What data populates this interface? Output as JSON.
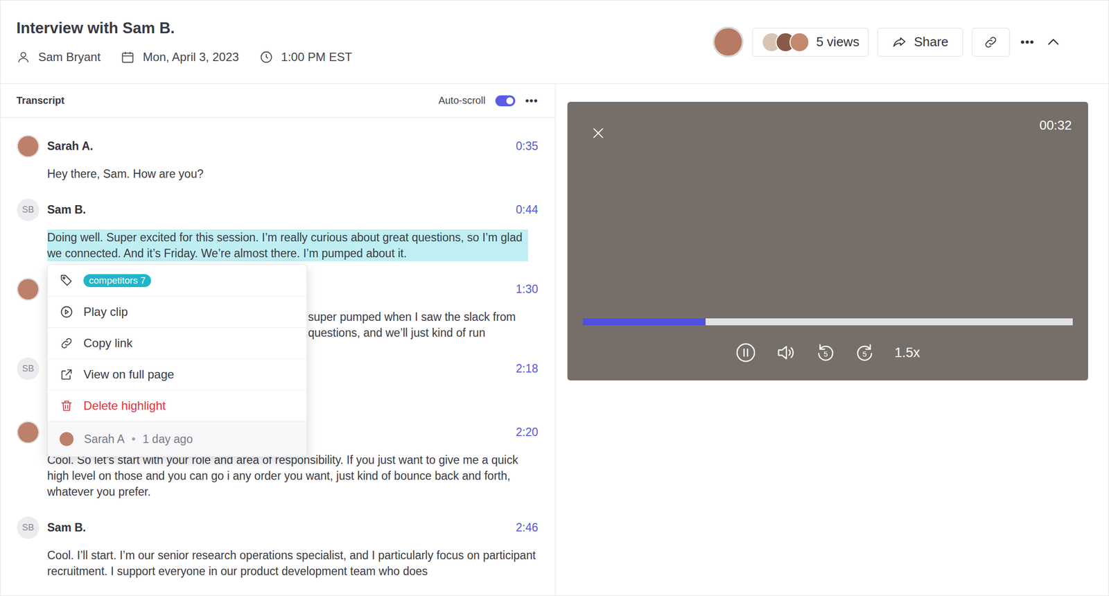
{
  "header": {
    "title": "Interview with Sam B.",
    "participant": "Sam Bryant",
    "date": "Mon, April 3, 2023",
    "time": "1:00 PM EST",
    "views": "5 views",
    "share": "Share",
    "more": "•••"
  },
  "transcript": {
    "title": "Transcript",
    "auto_scroll": {
      "label": "Auto-scroll",
      "on": true
    },
    "more": "•••",
    "entries": [
      {
        "kind": "full",
        "speaker": "Sarah A.",
        "avatar": {
          "kind": "photo"
        },
        "time": "0:35",
        "text": "Hey there, Sam. How are you?",
        "highlighted": false
      },
      {
        "kind": "full",
        "speaker": "Sam B.",
        "avatar": {
          "kind": "initials",
          "text": "SB"
        },
        "time": "0:44",
        "text": "Doing well. Super excited for this session. I’m really curious about great questions, so I’m glad we connected. And it’s Friday. We’re almost there. I’m pumped about it.",
        "highlighted": true
      },
      {
        "kind": "covered",
        "avatar": {
          "kind": "photo"
        },
        "time": "1:30",
        "lines": [
          "super pumped when I saw the slack from",
          "questions, and we’ll just kind of run"
        ],
        "highlighted": false
      },
      {
        "kind": "covered",
        "avatar": {
          "kind": "initials",
          "text": "SB"
        },
        "time": "2:18",
        "lines": [],
        "highlighted": false
      },
      {
        "kind": "full",
        "speaker": "Sarah A.",
        "avatar": {
          "kind": "photo"
        },
        "time": "2:20",
        "text": "Cool. So let’s start with your role and area of responsibility. If you just want to give me a quick high level on those and you can go i any order you want, just kind of bounce back and forth, whatever you prefer.",
        "highlighted": false
      },
      {
        "kind": "full",
        "speaker": "Sam B.",
        "avatar": {
          "kind": "initials",
          "text": "SB"
        },
        "time": "2:46",
        "text": "Cool. I’ll start. I’m our senior research operations specialist, and I particularly focus on participant recruitment. I support everyone in our product development team who does",
        "highlighted": false
      }
    ]
  },
  "highlight_menu": {
    "tag": "competitors 7",
    "items": [
      {
        "label": "Play clip",
        "kind": "normal"
      },
      {
        "label": "Copy link",
        "kind": "normal"
      },
      {
        "label": "View on full page",
        "kind": "normal"
      },
      {
        "label": "Delete highlight",
        "kind": "danger"
      }
    ],
    "footer": {
      "author": "Sarah A",
      "separator": "•",
      "age": "1 day ago"
    }
  },
  "video": {
    "time": "00:32",
    "progress": {
      "level": 0.25
    },
    "playing": true,
    "skip_back": "5",
    "skip_forward": "5",
    "speed": "1.5x"
  }
}
